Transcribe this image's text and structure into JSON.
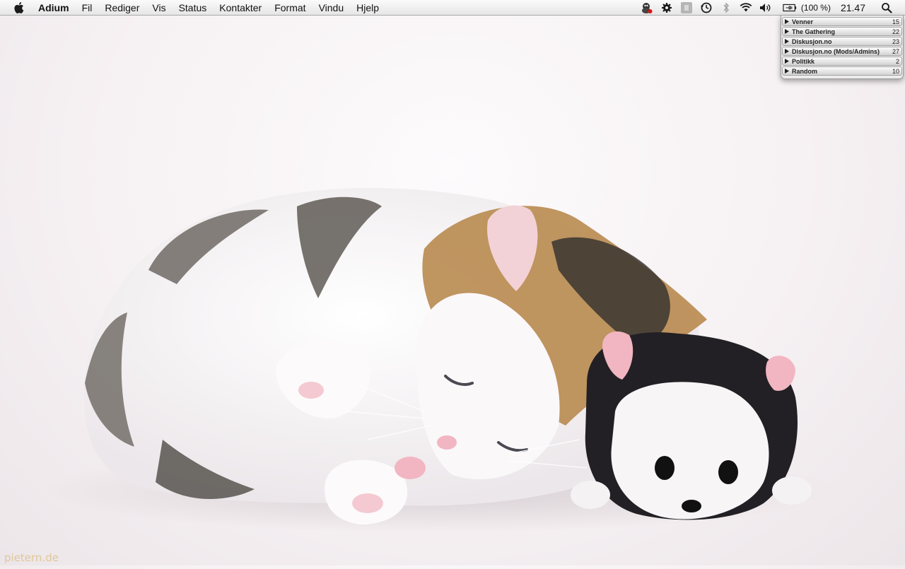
{
  "menubar": {
    "app_name": "Adium",
    "items": [
      "Fil",
      "Rediger",
      "Vis",
      "Status",
      "Kontakter",
      "Format",
      "Vindu",
      "Hjelp"
    ],
    "battery_text": "(100 %)",
    "clock": "21.47",
    "status_icons": [
      "adium-duck-icon",
      "gear-icon",
      "box-icon",
      "time-machine-icon",
      "bluetooth-icon",
      "wifi-icon",
      "volume-icon",
      "battery-icon",
      "spotlight-icon"
    ]
  },
  "contact_list": {
    "groups": [
      {
        "name": "Venner",
        "count": "15"
      },
      {
        "name": "The Gathering",
        "count": "22"
      },
      {
        "name": "Diskusjon.no",
        "count": "23"
      },
      {
        "name": "Diskusjon.no (Mods/Admins)",
        "count": "27"
      },
      {
        "name": "Politikk",
        "count": "2"
      },
      {
        "name": "Random",
        "count": "10"
      }
    ]
  },
  "wallpaper": {
    "watermark": "pietern.de"
  }
}
